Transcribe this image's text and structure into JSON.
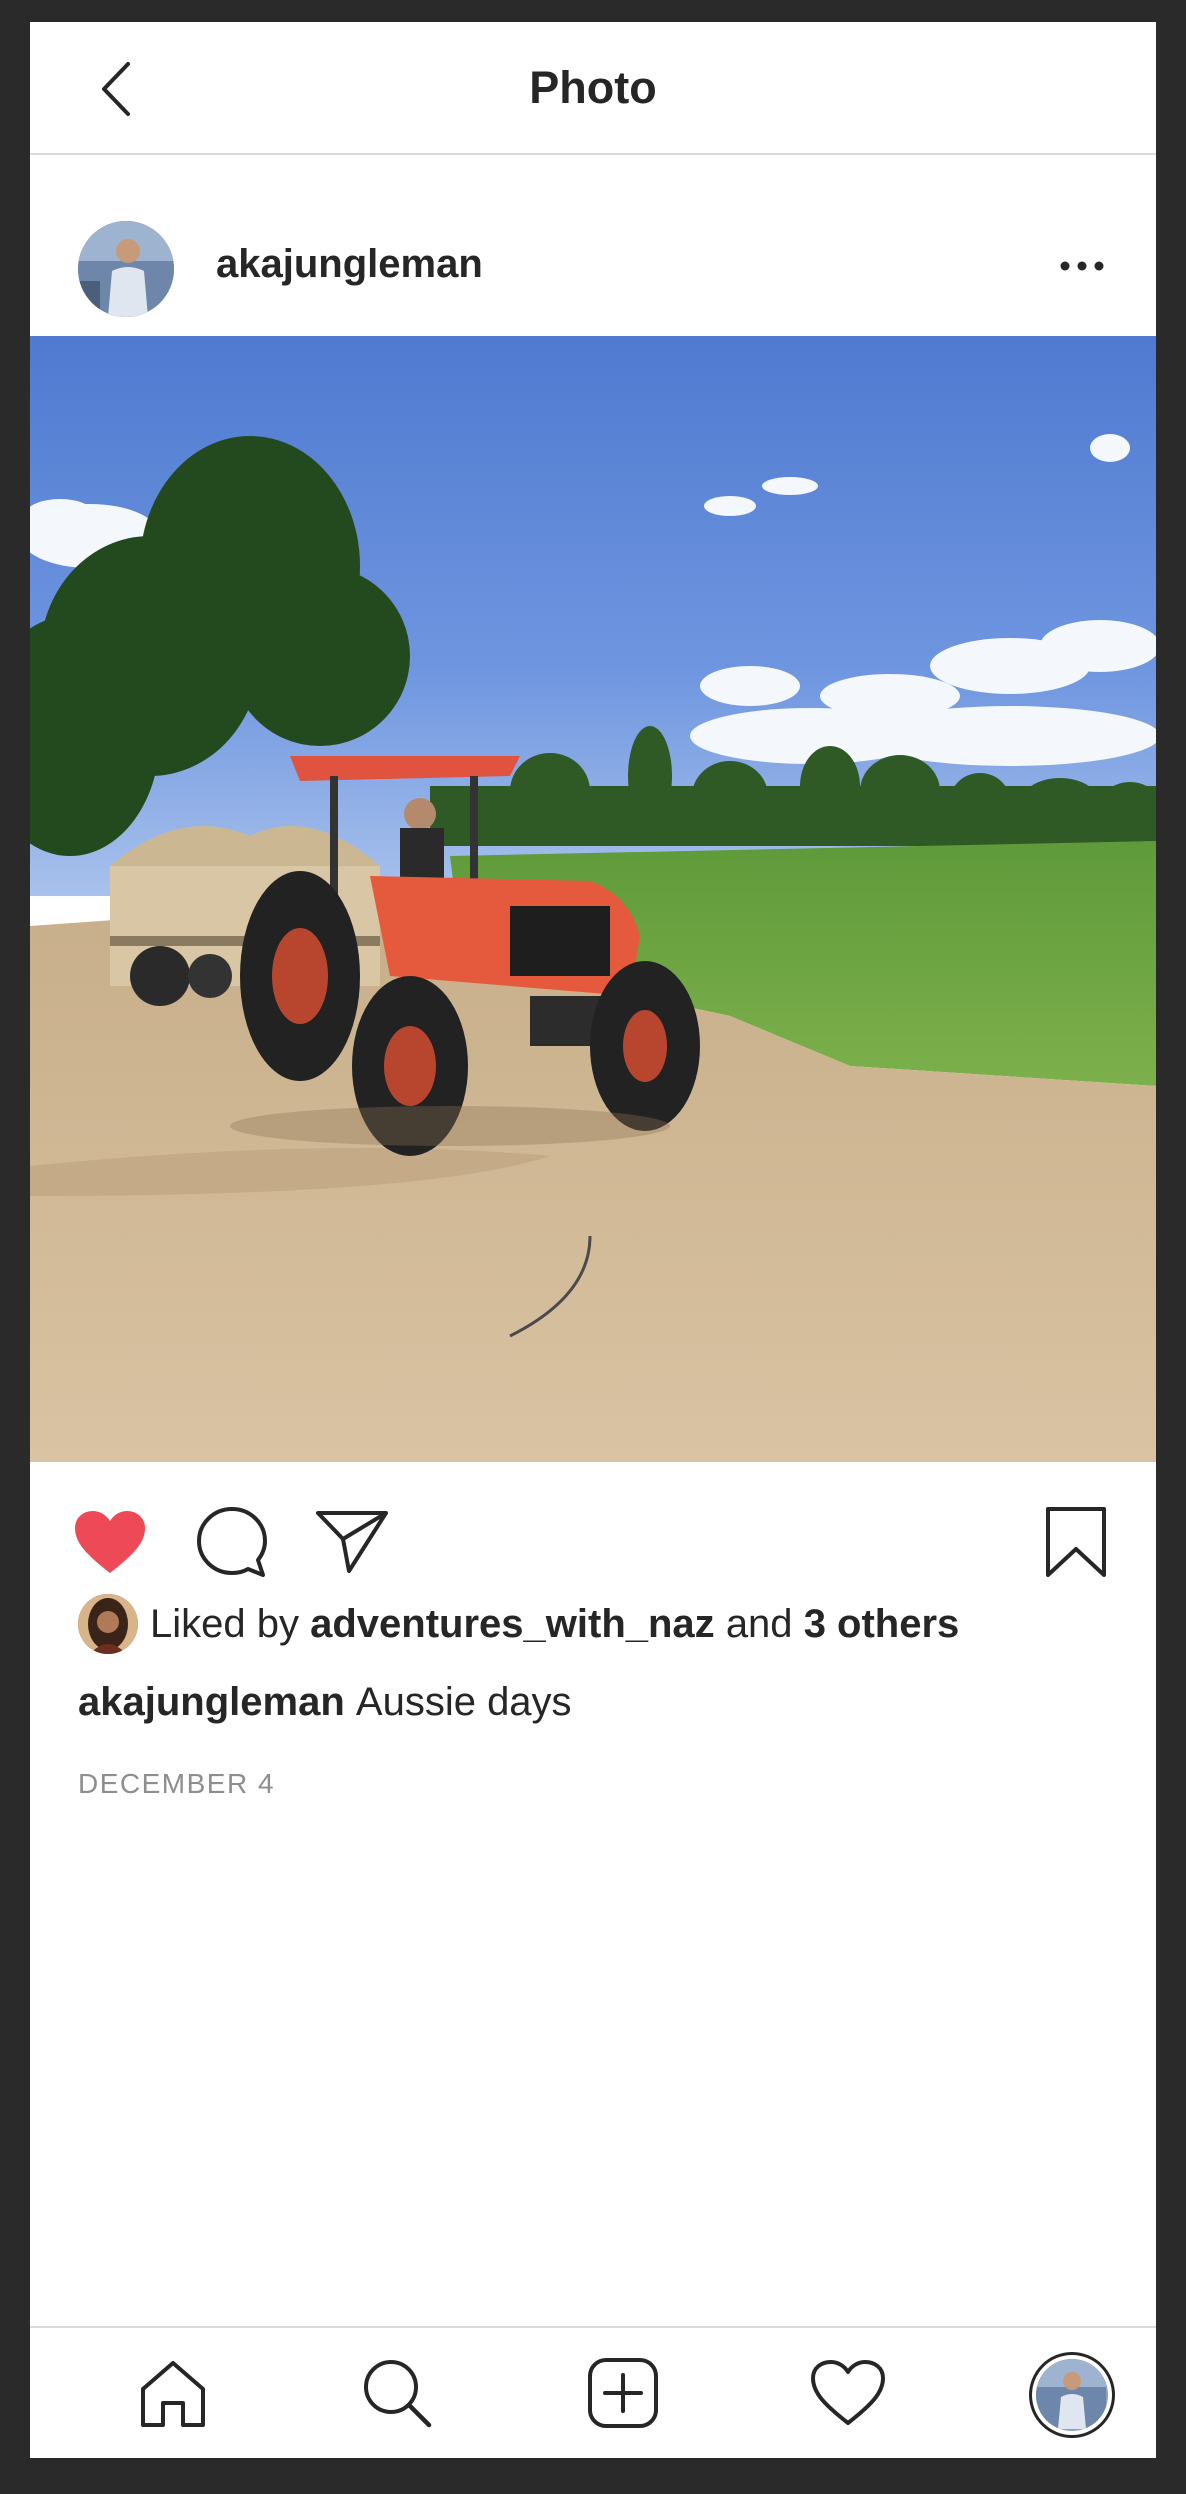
{
  "header": {
    "title": "Photo",
    "back_icon": "chevron-left-icon"
  },
  "post": {
    "username": "akajungleman",
    "more_icon": "more-horizontal-icon",
    "photo_description_icon": "tractor-photo",
    "liked": true,
    "likes": {
      "prefix": "Liked by",
      "user": "adventures_with_naz",
      "conjunction": "and",
      "others": "3 others"
    },
    "caption": {
      "username": "akajungleman",
      "text": "Aussie days"
    },
    "date": "DECEMBER 4"
  },
  "colors": {
    "like_red": "#ed4956",
    "text": "#262626",
    "muted": "#8e8e8e",
    "divider": "#dbdbdb"
  },
  "bottom_nav": {
    "items": [
      "home-icon",
      "search-icon",
      "add-post-icon",
      "activity-heart-icon",
      "profile-avatar"
    ]
  }
}
